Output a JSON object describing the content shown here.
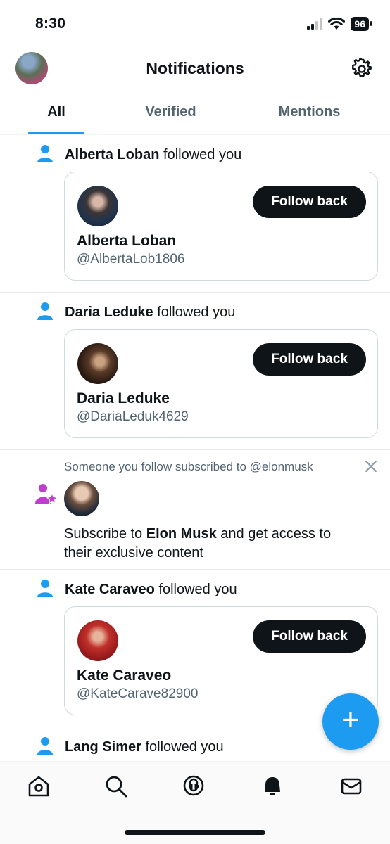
{
  "status_bar": {
    "time": "8:30",
    "battery": "96"
  },
  "header": {
    "title": "Notifications"
  },
  "tabs": [
    {
      "label": "All",
      "active": true
    },
    {
      "label": "Verified",
      "active": false
    },
    {
      "label": "Mentions",
      "active": false
    }
  ],
  "notifications": [
    {
      "type": "follow",
      "name": "Alberta Loban",
      "action": " followed you",
      "handle": "@AlbertaLob1806",
      "button": "Follow back"
    },
    {
      "type": "follow",
      "name": "Daria Leduke",
      "action": " followed you",
      "handle": "@DariaLeduk4629",
      "button": "Follow back"
    },
    {
      "type": "subscription",
      "context": "Someone you follow subscribed to @elonmusk",
      "pre": "Subscribe to ",
      "name": "Elon Musk",
      "post": " and get access to their exclusive content"
    },
    {
      "type": "follow",
      "name": "Kate Caraveo",
      "action": " followed you",
      "handle": "@KateCarave82900",
      "button": "Follow back"
    },
    {
      "type": "follow",
      "name": "Lang Simer",
      "action": " followed you"
    }
  ],
  "fab": {
    "icon": "plus-icon",
    "label": "+"
  },
  "bottom_nav": [
    "home-icon",
    "search-icon",
    "spaces-icon",
    "notifications-bell-icon",
    "messages-icon"
  ],
  "colors": {
    "accent": "#1d9bf0",
    "text": "#0f1419",
    "muted": "#536471",
    "subscription_icon": "#c13dd0"
  }
}
